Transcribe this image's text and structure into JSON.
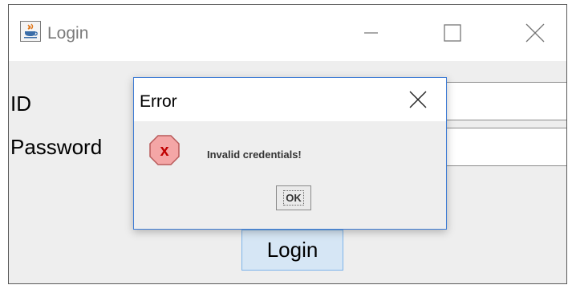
{
  "window": {
    "title": "Login",
    "controls": {
      "minimize_icon": "minimize-icon",
      "maximize_icon": "maximize-icon",
      "close_icon": "close-icon"
    }
  },
  "form": {
    "id_label": "ID",
    "password_label": "Password",
    "id_value": "",
    "password_value": "",
    "login_button": "Login"
  },
  "dialog": {
    "title": "Error",
    "message": "Invalid credentials!",
    "ok_button": "OK",
    "icon_letter": "x",
    "icon": "error-icon"
  },
  "colors": {
    "dialog_border": "#3d7bd4",
    "error_icon_fill": "#f4a6a6",
    "error_letter": "#c00000",
    "login_button_bg": "#d6e6f5",
    "login_button_border": "#7eb4ea"
  }
}
